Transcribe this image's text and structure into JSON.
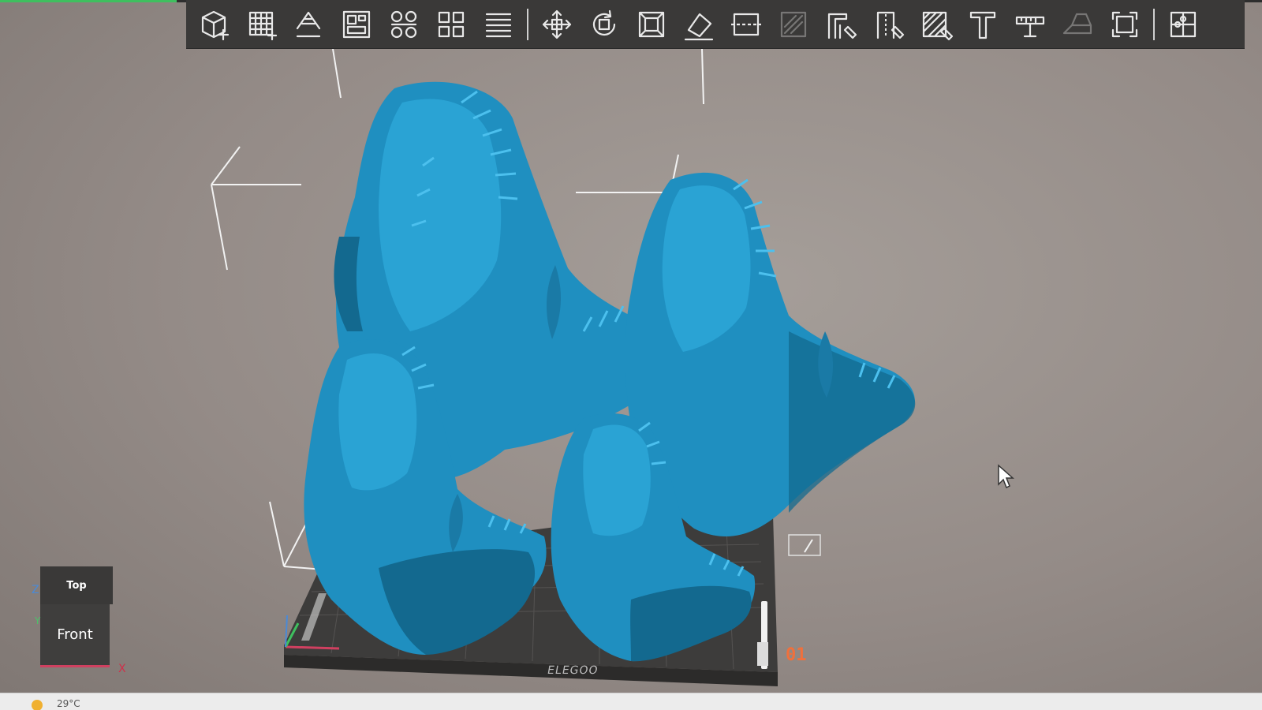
{
  "app": {
    "progress_fraction": 0.14
  },
  "toolbar": {
    "tools": [
      {
        "name": "add-model-icon",
        "enabled": true
      },
      {
        "name": "grid-add-icon",
        "enabled": true
      },
      {
        "name": "auto-orient-icon",
        "enabled": true
      },
      {
        "name": "layout-icon",
        "enabled": true
      },
      {
        "name": "arrange-icon",
        "enabled": true
      },
      {
        "name": "duplicate-icon",
        "enabled": true
      },
      {
        "name": "layers-icon",
        "enabled": true
      },
      {
        "name": "move-icon",
        "enabled": true
      },
      {
        "name": "rotate-icon",
        "enabled": true
      },
      {
        "name": "scale-icon",
        "enabled": true
      },
      {
        "name": "place-on-face-icon",
        "enabled": true
      },
      {
        "name": "cut-icon",
        "enabled": true
      },
      {
        "name": "hollow-icon",
        "enabled": false
      },
      {
        "name": "support-paint-icon",
        "enabled": true
      },
      {
        "name": "seam-paint-icon",
        "enabled": true
      },
      {
        "name": "infill-paint-icon",
        "enabled": true
      },
      {
        "name": "text-tool-icon",
        "enabled": true
      },
      {
        "name": "measure-icon",
        "enabled": true
      },
      {
        "name": "emboss-icon",
        "enabled": false
      },
      {
        "name": "fit-view-icon",
        "enabled": true
      },
      {
        "name": "assembly-icon",
        "enabled": true
      }
    ]
  },
  "view_cube": {
    "top_label": "Top",
    "front_label": "Front",
    "axis_z": "Z",
    "axis_y": "Y",
    "axis_x": "X"
  },
  "plate": {
    "number": "01",
    "brand": "ELEGOO"
  },
  "taskbar": {
    "temperature": "29°C"
  },
  "colors": {
    "model": "#1f8fc0",
    "model_shadow": "#13698f",
    "accent": "#f0703c",
    "toolbar_bg": "#3a3938"
  }
}
